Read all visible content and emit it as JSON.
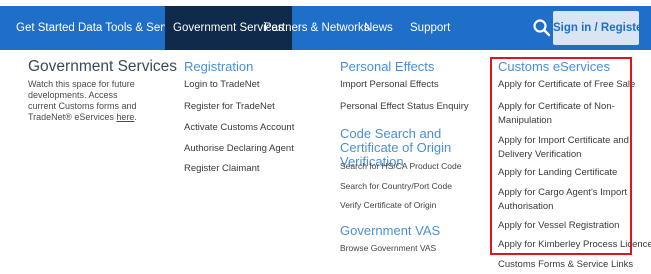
{
  "nav": {
    "items": [
      {
        "label": "Get Started"
      },
      {
        "label": "Data Tools & Services"
      },
      {
        "label": "Government Services"
      },
      {
        "label": "Partners & Networks"
      },
      {
        "label": "News"
      },
      {
        "label": "Support"
      }
    ],
    "search_icon": "search-icon",
    "sign_in_label": "Sign in / Register"
  },
  "menu": {
    "government_services": {
      "title": "Government Services",
      "desc_text": "Watch this space for future developments. Access current Customs forms and TradeNet® eServices ",
      "desc_link": "here",
      "desc_end": "."
    },
    "registration": {
      "title": "Registration",
      "links": [
        "Login to TradeNet",
        "Register for TradeNet",
        "Activate Customs Account",
        "Authorise Declaring Agent",
        "Register Claimant"
      ]
    },
    "personal_effects": {
      "title": "Personal Effects",
      "links": [
        "Import Personal Effects",
        "Personal Effect Status Enquiry"
      ]
    },
    "code_search": {
      "title": "Code Search and Certificate of Origin Verification",
      "links": [
        "Search for HS/CA Product Code",
        "Search for Country/Port Code",
        "Verify Certificate of Origin"
      ]
    },
    "government_vas": {
      "title": "Government VAS",
      "links": [
        "Browse Government VAS"
      ]
    },
    "customs_eservices": {
      "title": "Customs eServices",
      "links": [
        "Apply for Certificate of Free Sale",
        "Apply for Certificate of Non-Manipulation",
        "Apply for Import Certificate and Delivery Verification",
        "Apply for Landing Certificate",
        "Apply for Cargo Agent's Import Authorisation",
        "Apply for Vessel Registration",
        "Apply for Kimberley Process Licence",
        "Customs Forms & Service Links"
      ]
    }
  },
  "colors": {
    "nav_bg": "#1f6ec8",
    "nav_active_bg": "#0f2a4a",
    "title_blue": "#4a8fd6",
    "highlight_red": "#e0141e"
  }
}
